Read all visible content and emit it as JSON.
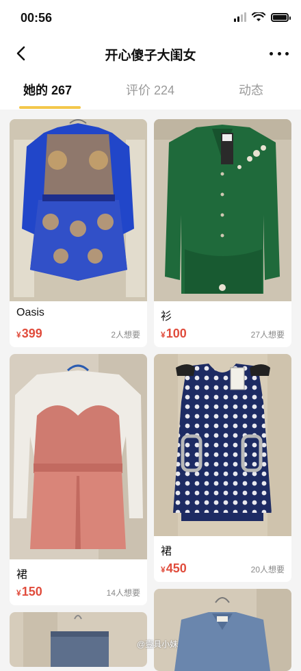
{
  "status_bar": {
    "time": "00:56"
  },
  "nav": {
    "title": "开心傻子大闺女"
  },
  "tabs": [
    {
      "label": "她的 267",
      "active": true
    },
    {
      "label": "评价 224",
      "active": false
    },
    {
      "label": "动态",
      "active": false
    }
  ],
  "listings": [
    {
      "name": "Oasis",
      "currency": "¥",
      "price": "399",
      "wants": "2人想要"
    },
    {
      "name": "衫",
      "currency": "¥",
      "price": "100",
      "wants": "27人想要"
    },
    {
      "name": "裙",
      "currency": "¥",
      "price": "150",
      "wants": "14人想要"
    },
    {
      "name": "裙",
      "currency": "¥",
      "price": "450",
      "wants": "20人想要"
    }
  ],
  "watermark": "@壹具小妹",
  "colors": {
    "accent": "#f3c74b",
    "price": "#e04c3c"
  }
}
